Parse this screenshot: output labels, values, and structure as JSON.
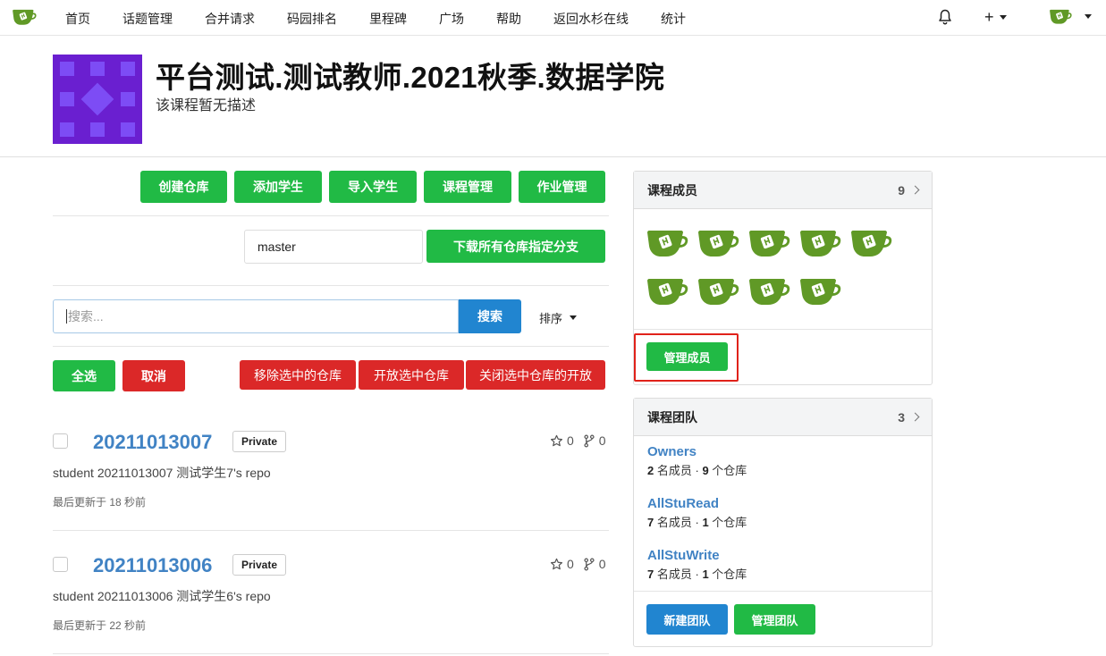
{
  "nav": {
    "items": [
      "首页",
      "话题管理",
      "合并请求",
      "码园排名",
      "里程碑",
      "广场",
      "帮助",
      "返回水杉在线",
      "统计"
    ],
    "plus": "+"
  },
  "org": {
    "title": "平台测试.测试教师.2021秋季.数据学院",
    "description": "该课程暂无描述"
  },
  "actions": {
    "create_repo": "创建仓库",
    "add_student": "添加学生",
    "import_student": "导入学生",
    "course_manage": "课程管理",
    "homework_manage": "作业管理",
    "branch_value": "master",
    "download_branch": "下载所有仓库指定分支",
    "search_placeholder": "搜索...",
    "search_button": "搜索",
    "sort_label": "排序",
    "select_all": "全选",
    "cancel": "取消",
    "remove_selected": "移除选中的仓库",
    "open_selected": "开放选中仓库",
    "close_selected": "关闭选中仓库的开放"
  },
  "repos": [
    {
      "name": "20211013007",
      "visibility": "Private",
      "stars": "0",
      "forks": "0",
      "description": "student 20211013007 测试学生7's repo",
      "updated": "最后更新于 18 秒前"
    },
    {
      "name": "20211013006",
      "visibility": "Private",
      "stars": "0",
      "forks": "0",
      "description": "student 20211013006 测试学生6's repo",
      "updated": "最后更新于 22 秒前"
    }
  ],
  "members_panel": {
    "title": "课程成员",
    "count": "9",
    "manage_button": "管理成员"
  },
  "teams_panel": {
    "title": "课程团队",
    "count": "3",
    "teams": [
      {
        "name": "Owners",
        "members": "2",
        "members_label": "名成员",
        "repos": "9",
        "repos_label": "个仓库"
      },
      {
        "name": "AllStuRead",
        "members": "7",
        "members_label": "名成员",
        "repos": "1",
        "repos_label": "个仓库"
      },
      {
        "name": "AllStuWrite",
        "members": "7",
        "members_label": "名成员",
        "repos": "1",
        "repos_label": "个仓库"
      }
    ],
    "new_team": "新建团队",
    "manage_team": "管理团队"
  },
  "colors": {
    "green": "#21ba45",
    "red": "#db2828",
    "blue": "#2185d0",
    "link": "#4183c4",
    "highlight": "#e0221a",
    "gitea_green": "#609926",
    "org_avatar_purple": "#6a1fd0"
  }
}
